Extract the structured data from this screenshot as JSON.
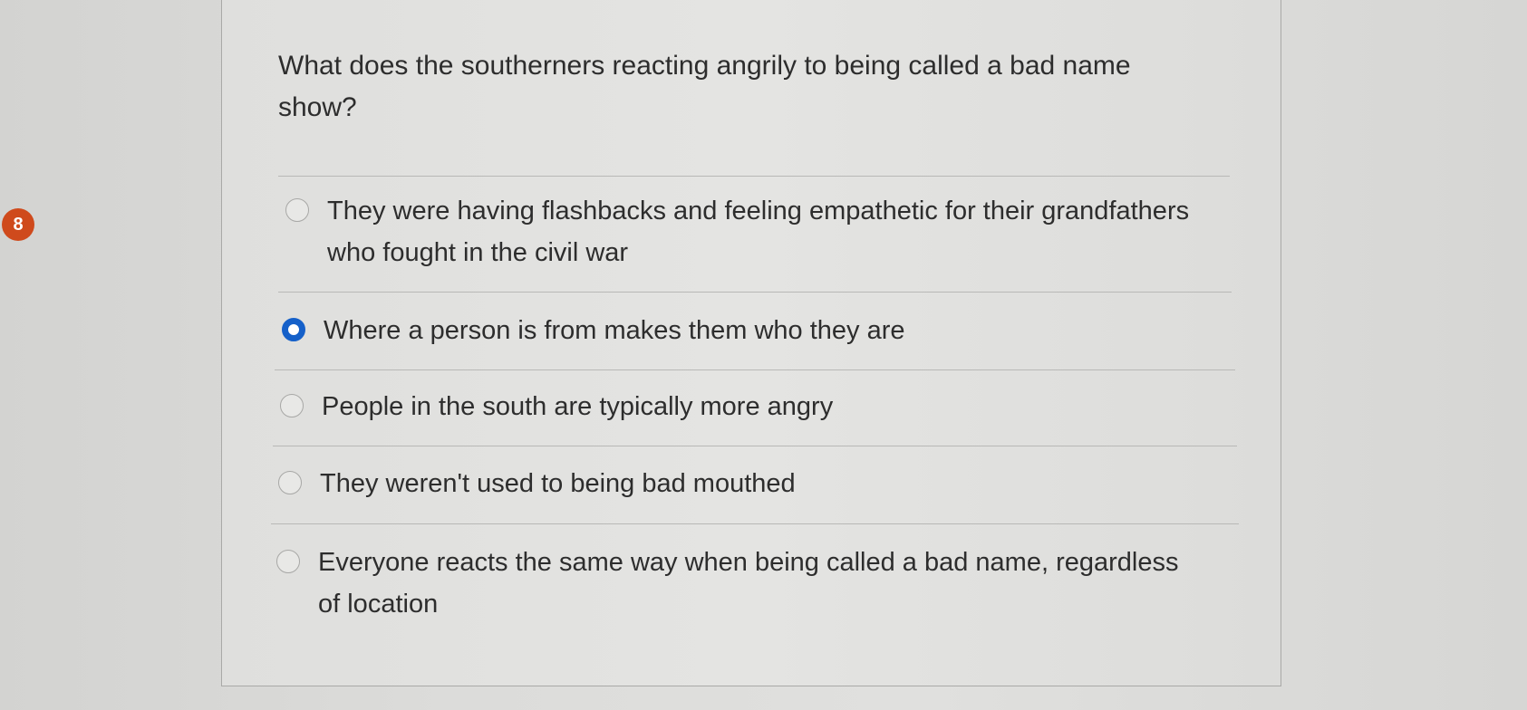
{
  "question_number": "8",
  "question": {
    "text": "What does the southerners reacting angrily to being called a bad name show?"
  },
  "options": [
    {
      "label": "They were having flashbacks and feeling empathetic for their grandfathers who fought in the civil war",
      "selected": false
    },
    {
      "label": "Where a person is from makes them who they are",
      "selected": true
    },
    {
      "label": "People in the south are typically more angry",
      "selected": false
    },
    {
      "label": "They weren't used to being bad mouthed",
      "selected": false
    },
    {
      "label": "Everyone reacts the same way when being called a bad name, regardless of location",
      "selected": false
    }
  ],
  "colors": {
    "badge": "#cf4a1c",
    "selected_radio": "#1560c9"
  }
}
